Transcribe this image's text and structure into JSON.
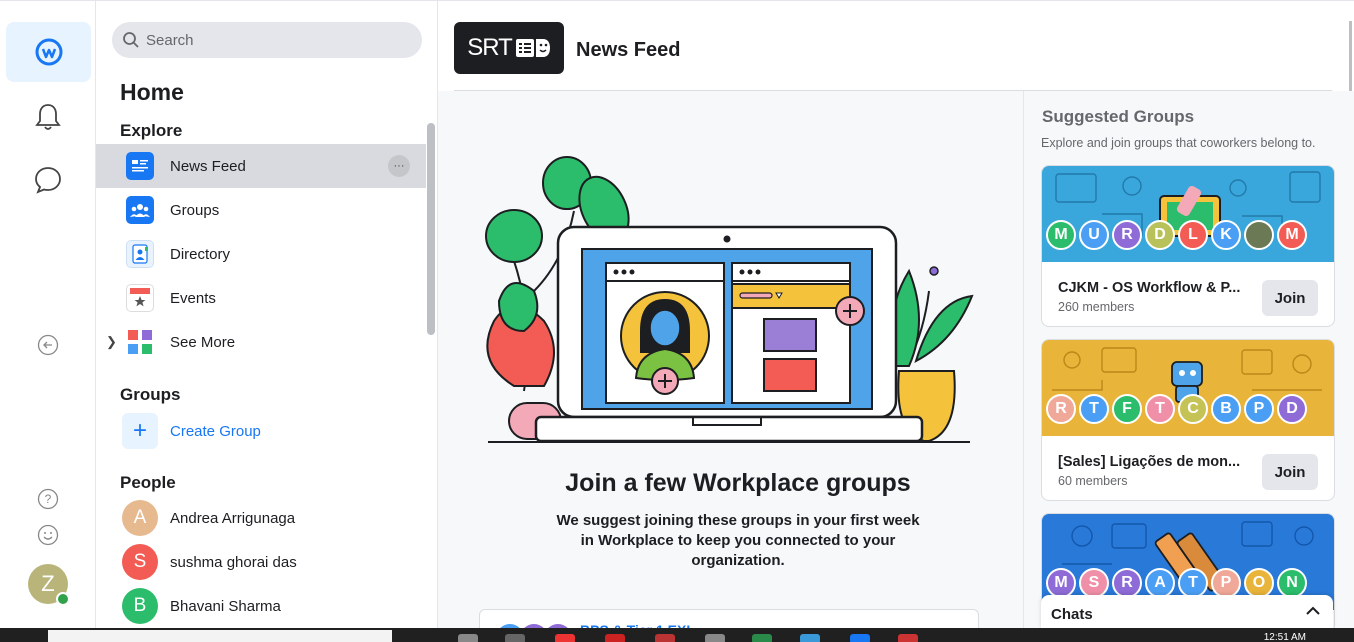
{
  "search": {
    "placeholder": "Search"
  },
  "nav": {
    "home": "Home",
    "explore_title": "Explore",
    "items": [
      {
        "label": "News Feed"
      },
      {
        "label": "Groups"
      },
      {
        "label": "Directory"
      },
      {
        "label": "Events"
      },
      {
        "label": "See More"
      }
    ],
    "more_dots": "···",
    "groups_title": "Groups",
    "create_group": "Create Group",
    "people_title": "People",
    "people": [
      {
        "name": "Andrea Arrigunaga",
        "initial": "A",
        "color": "#e7b98f"
      },
      {
        "name": "sushma ghorai das",
        "initial": "S",
        "color": "#f25c54"
      },
      {
        "name": "Bhavani Sharma",
        "initial": "B",
        "color": "#2bbd6b"
      }
    ]
  },
  "rail": {
    "user_initial": "Z"
  },
  "header": {
    "brand": "SRT",
    "title": "News Feed"
  },
  "feed": {
    "heading": "Join a few Workplace groups",
    "description": "We suggest joining these groups in your first week in Workplace to keep you connected to your organization.",
    "card_label": "BPS & Tier 1 EXL"
  },
  "suggested": {
    "title": "Suggested Groups",
    "subtitle": "Explore and join groups that coworkers belong to.",
    "groups": [
      {
        "name": "CJKM - OS Workflow & P...",
        "members": "260 members",
        "join": "Join",
        "banner": "#3aa7dc",
        "bubbles": [
          {
            "l": "M",
            "c": "#2bbd6b"
          },
          {
            "l": "U",
            "c": "#4a9ff5"
          },
          {
            "l": "R",
            "c": "#8e6bd6"
          },
          {
            "l": "D",
            "c": "#b9c25a"
          },
          {
            "l": "L",
            "c": "#f25c54"
          },
          {
            "l": "K",
            "c": "#4a9ff5"
          },
          {
            "l": "",
            "c": "#6b7a55"
          },
          {
            "l": "M",
            "c": "#f25c54"
          }
        ]
      },
      {
        "name": "[Sales] Ligações de mon...",
        "members": "60 members",
        "join": "Join",
        "banner": "#e9b43a",
        "bubbles": [
          {
            "l": "R",
            "c": "#f0a898"
          },
          {
            "l": "T",
            "c": "#4a9ff5"
          },
          {
            "l": "F",
            "c": "#2bbd6b"
          },
          {
            "l": "T",
            "c": "#f08fa8"
          },
          {
            "l": "C",
            "c": "#c6c356"
          },
          {
            "l": "B",
            "c": "#4a9ff5"
          },
          {
            "l": "P",
            "c": "#4a9ff5"
          },
          {
            "l": "D",
            "c": "#8e6bd6"
          }
        ]
      },
      {
        "name": "",
        "members": "",
        "join": "",
        "banner": "#2979d9",
        "bubbles": [
          {
            "l": "M",
            "c": "#8e6bd6"
          },
          {
            "l": "S",
            "c": "#f08fa8"
          },
          {
            "l": "R",
            "c": "#8e6bd6"
          },
          {
            "l": "A",
            "c": "#4a9ff5"
          },
          {
            "l": "T",
            "c": "#4a9ff5"
          },
          {
            "l": "P",
            "c": "#f0a898"
          },
          {
            "l": "O",
            "c": "#e9b43a"
          },
          {
            "l": "N",
            "c": "#2bbd6b"
          }
        ]
      }
    ]
  },
  "chats": {
    "label": "Chats"
  },
  "taskbar": {
    "time": "12:51 AM"
  }
}
